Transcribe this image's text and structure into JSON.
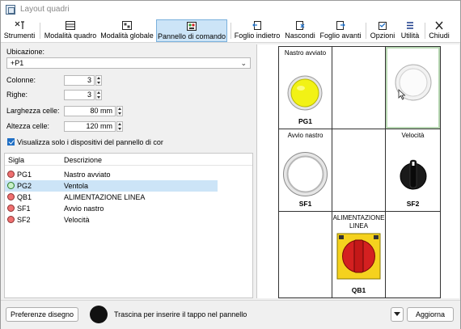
{
  "window": {
    "title": "Layout quadri"
  },
  "toolbar": {
    "items": [
      {
        "label": "Strumenti",
        "icon": "tools-icon"
      },
      {
        "label": "Modalità quadro",
        "icon": "panel-mode-icon"
      },
      {
        "label": "Modalità globale",
        "icon": "global-mode-icon"
      },
      {
        "label": "Pannello di comando",
        "icon": "control-panel-icon",
        "active": true
      },
      {
        "label": "Foglio indietro",
        "icon": "sheet-back-icon"
      },
      {
        "label": "Nascondi",
        "icon": "hide-icon"
      },
      {
        "label": "Foglio avanti",
        "icon": "sheet-forward-icon"
      },
      {
        "label": "Opzioni",
        "icon": "options-icon"
      },
      {
        "label": "Utilità",
        "icon": "utility-icon"
      },
      {
        "label": "Chiudi",
        "icon": "close-icon"
      }
    ]
  },
  "form": {
    "ubicazione_label": "Ubicazione:",
    "ubicazione_value": "+P1",
    "colonne_label": "Colonne:",
    "colonne_value": "3",
    "righe_label": "Righe:",
    "righe_value": "3",
    "larghezza_label": "Larghezza celle:",
    "larghezza_value": "80 mm",
    "altezza_label": "Altezza celle:",
    "altezza_value": "120 mm",
    "checkbox_label": "Visualizza solo i dispositivi del pannello di cor",
    "checkbox_checked": true
  },
  "list": {
    "headers": {
      "sigla": "Sigla",
      "descrizione": "Descrizione"
    },
    "rows": [
      {
        "sigla": "PG1",
        "descrizione": "Nastro avviato",
        "selected": false
      },
      {
        "sigla": "PG2",
        "descrizione": "Ventola",
        "selected": true
      },
      {
        "sigla": "QB1",
        "descrizione": "ALIMENTAZIONE LINEA",
        "selected": false
      },
      {
        "sigla": "SF1",
        "descrizione": "Avvio nastro",
        "selected": false
      },
      {
        "sigla": "SF2",
        "descrizione": "Velocità",
        "selected": false
      }
    ]
  },
  "panel": {
    "cells": [
      {
        "top": "Nastro avviato",
        "bottom": "PG1",
        "device": "yellow-lamp"
      },
      {
        "top": "",
        "bottom": "",
        "device": "empty"
      },
      {
        "top": "",
        "bottom": "",
        "device": "white-lamp-highlight"
      },
      {
        "top": "Avvio nastro",
        "bottom": "SF1",
        "device": "white-pushbutton"
      },
      {
        "top": "",
        "bottom": "",
        "device": "empty"
      },
      {
        "top": "Velocità",
        "bottom": "SF2",
        "device": "black-selector"
      },
      {
        "top": "",
        "bottom": "",
        "device": "empty"
      },
      {
        "top": "ALIMENTAZIONE LINEA",
        "bottom": "QB1",
        "device": "main-switch"
      },
      {
        "top": "",
        "bottom": "",
        "device": "empty"
      }
    ]
  },
  "bottom": {
    "preferenze_label": "Preferenze disegno",
    "hint": "Trascina per inserire il tappo nel pannello",
    "aggiorna_label": "Aggiorna"
  },
  "colors": {
    "selection": "#cce4f7",
    "lamp_yellow": "#f2f215",
    "switch_red": "#d42020",
    "switch_yellow": "#f5d21e",
    "highlight_green": "#b9d9b4"
  }
}
